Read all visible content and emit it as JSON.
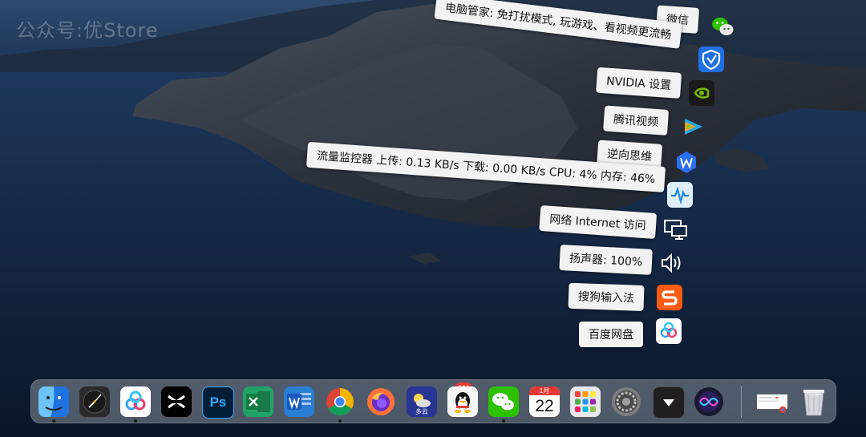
{
  "watermark": "公众号:优Store",
  "tray": [
    {
      "tooltip": "微信",
      "icon": "wechat-icon"
    },
    {
      "tooltip": "电脑管家: 免打扰模式,  玩游戏、看视频更流畅",
      "icon": "tencent-pc-manager-icon"
    },
    {
      "tooltip": "NVIDIA 设置",
      "icon": "nvidia-icon"
    },
    {
      "tooltip": "腾讯视频",
      "icon": "tencent-video-icon"
    },
    {
      "tooltip": "逆向思维",
      "icon": "nixiang-siwei-icon"
    },
    {
      "tooltip": "流量监控器 上传: 0.13 KB/s 下载: 0.00 KB/s CPU: 4% 内存: 46%",
      "icon": "traffic-monitor-icon"
    },
    {
      "tooltip": "网络 Internet 访问",
      "icon": "network-icon"
    },
    {
      "tooltip": "扬声器: 100%",
      "icon": "speaker-icon"
    },
    {
      "tooltip": "搜狗输入法",
      "icon": "sogou-input-icon"
    },
    {
      "tooltip": "百度网盘",
      "icon": "baidu-netdisk-icon"
    }
  ],
  "dock": {
    "items": [
      {
        "name": "finder",
        "icon": "finder-icon",
        "running": true
      },
      {
        "name": "clock",
        "icon": "clock-icon",
        "running": false
      },
      {
        "name": "baidu-netdisk",
        "icon": "baidu-netdisk-icon",
        "running": true
      },
      {
        "name": "capcut",
        "icon": "capcut-icon",
        "running": false
      },
      {
        "name": "photoshop",
        "icon": "photoshop-icon",
        "running": false
      },
      {
        "name": "excel",
        "icon": "excel-icon",
        "running": false
      },
      {
        "name": "word",
        "icon": "word-icon",
        "running": false
      },
      {
        "name": "chrome",
        "icon": "chrome-icon",
        "running": true
      },
      {
        "name": "firefox",
        "icon": "firefox-icon",
        "running": false
      },
      {
        "name": "weather",
        "icon": "weather-icon",
        "running": false
      },
      {
        "name": "qq",
        "icon": "qq-icon",
        "running": false
      },
      {
        "name": "wechat",
        "icon": "wechat-icon",
        "running": true
      },
      {
        "name": "calendar",
        "icon": "calendar-icon",
        "running": false
      },
      {
        "name": "launchpad",
        "icon": "launchpad-icon",
        "running": false
      },
      {
        "name": "system-preferences",
        "icon": "gear-icon",
        "running": false
      },
      {
        "name": "show-hidden",
        "icon": "chevron-down-icon",
        "running": false
      },
      {
        "name": "siri",
        "icon": "siri-icon",
        "running": false
      },
      {
        "name": "screenshot-preview",
        "icon": "screenshot-thumbnail",
        "running": false
      },
      {
        "name": "trash",
        "icon": "trash-icon",
        "running": false
      }
    ],
    "ps_label": "Ps",
    "weather_badge": "21°",
    "weather_label": "多云",
    "calendar_month": "1月",
    "calendar_day": "22"
  },
  "colors": {
    "sea": "#142744",
    "tooltip_bg": "#f2f2f2",
    "badge_red": "#e53935"
  }
}
